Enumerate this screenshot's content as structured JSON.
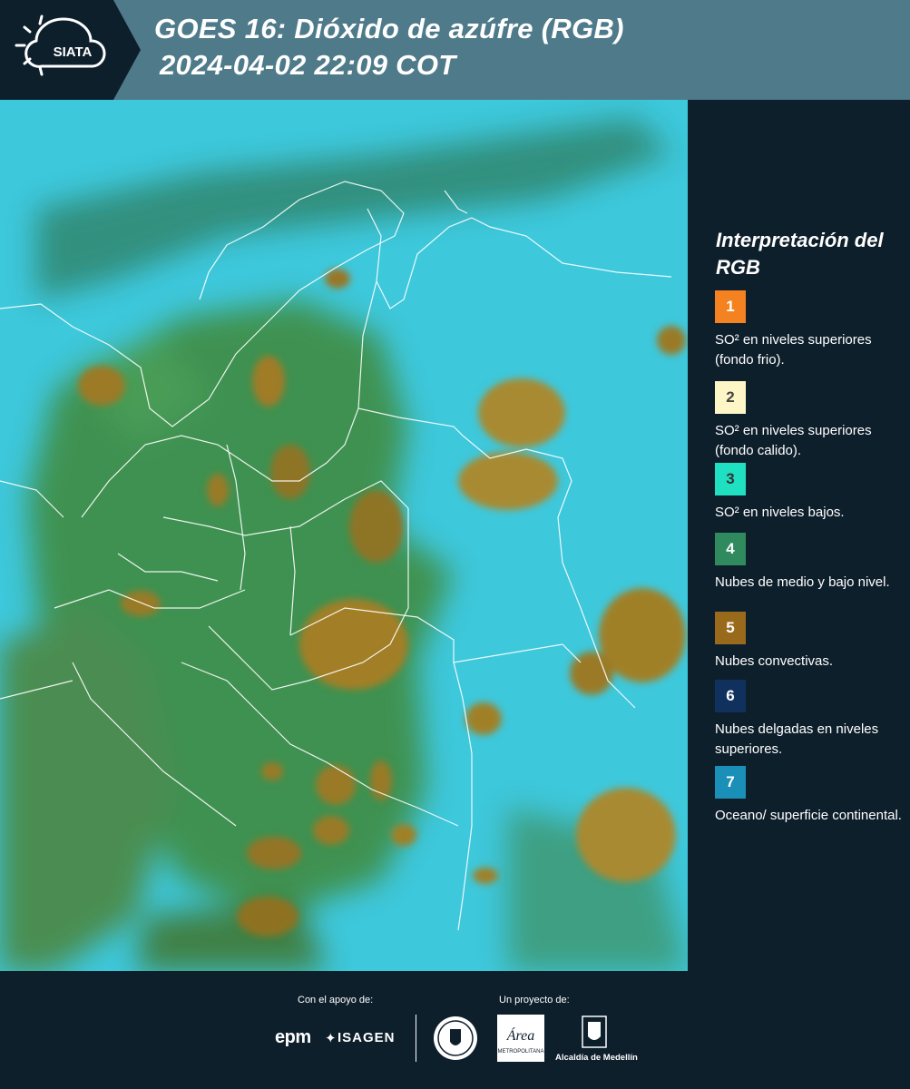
{
  "header": {
    "logo_text": "SIATA",
    "title_line1": "GOES 16: Dióxido de azúfre (RGB)",
    "title_line2": "2024-04-02 22:09 COT"
  },
  "legend": {
    "title": "Interpretación del RGB",
    "items": [
      {
        "number": "1",
        "label": "SO² en niveles superiores (fondo frio).",
        "color": "#f58220",
        "text_color": "#ffffff"
      },
      {
        "number": "2",
        "label": "SO² en niveles superiores (fondo calido).",
        "color": "#fff6c8",
        "text_color": "#444444"
      },
      {
        "number": "3",
        "label": "SO² en niveles bajos.",
        "color": "#1fe0c0",
        "text_color": "#333333"
      },
      {
        "number": "4",
        "label": "Nubes de medio y bajo nivel.",
        "color": "#2f8a5e",
        "text_color": "#ffffff"
      },
      {
        "number": "5",
        "label": "Nubes convectivas.",
        "color": "#9a6a1c",
        "text_color": "#ffffff"
      },
      {
        "number": "6",
        "label": "Nubes delgadas en niveles superiores.",
        "color": "#10305e",
        "text_color": "#ffffff"
      },
      {
        "number": "7",
        "label": "Oceano/ superficie continental.",
        "color": "#1a8fb8",
        "text_color": "#ffffff"
      }
    ]
  },
  "footer": {
    "support_label": "Con el apoyo de:",
    "project_label": "Un proyecto de:",
    "sponsor1": "epm",
    "sponsor2": "ISAGEN",
    "area_text": "Área",
    "area_subtext": "METROPOLITANA",
    "alcaldia": "Alcaldía de Medellín"
  }
}
